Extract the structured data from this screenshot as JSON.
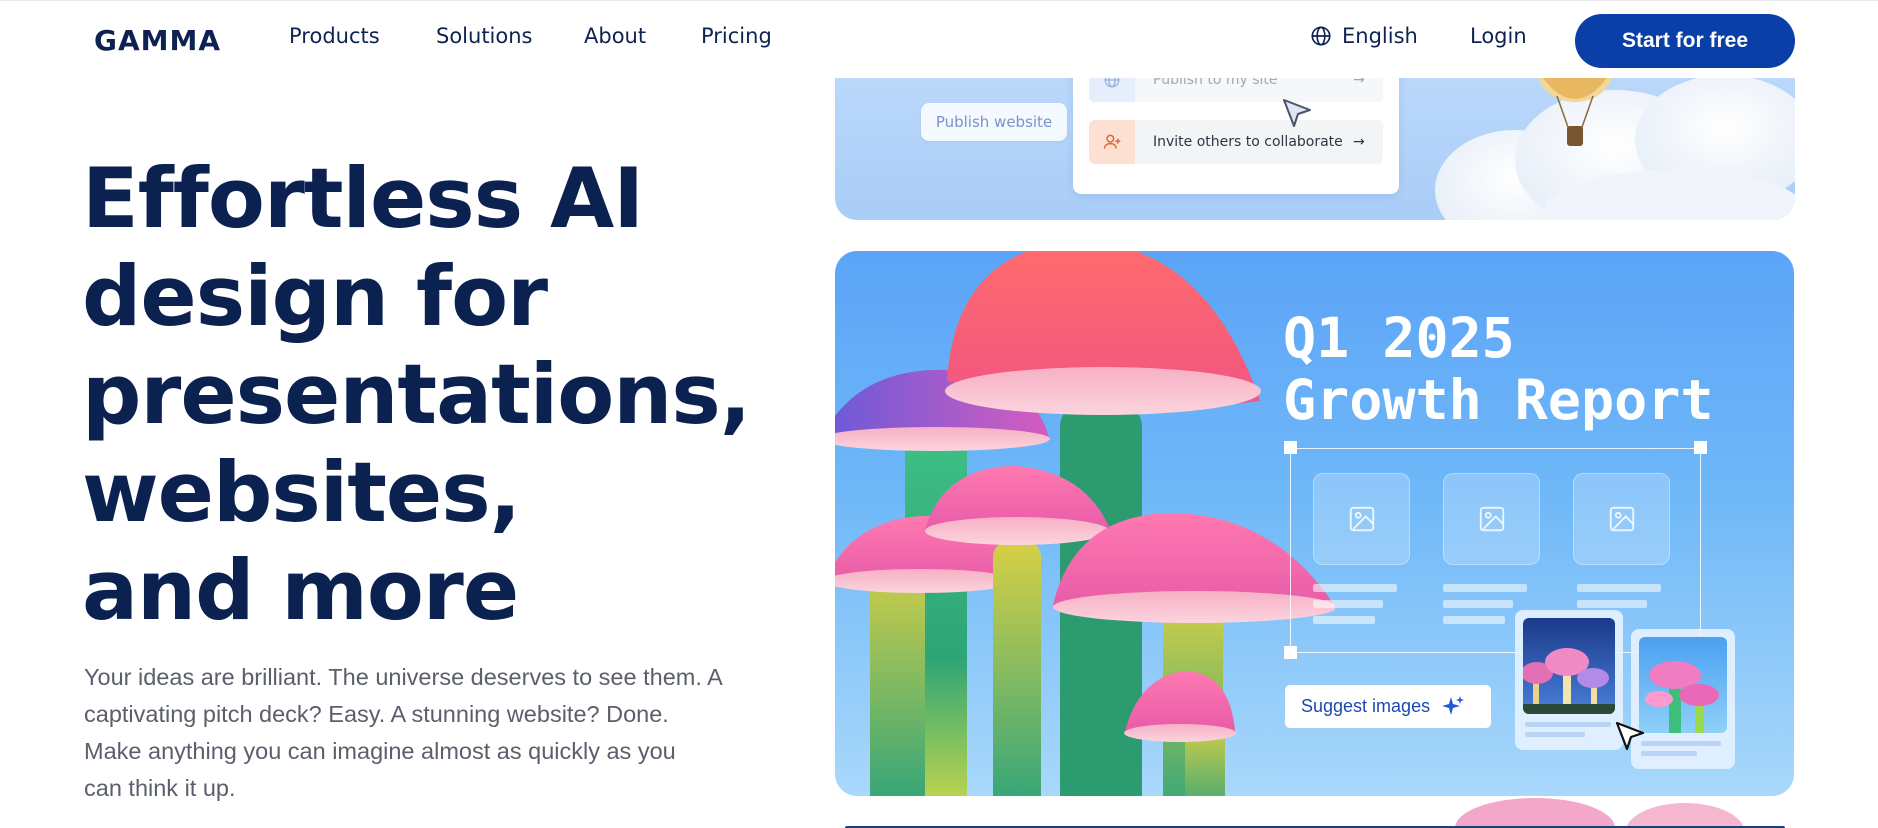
{
  "nav": {
    "logo": "GAMMA",
    "links": [
      "Products",
      "Solutions",
      "About",
      "Pricing"
    ],
    "language": "English",
    "login": "Login",
    "cta": "Start for free"
  },
  "hero": {
    "title_lines": [
      "Effortless AI",
      "design for",
      "presentations,",
      "websites,",
      "and more"
    ],
    "subtitle_lines": [
      "Your ideas are brilliant. The universe deserves to see them. A",
      "captivating pitch deck? Easy. A stunning website? Done.",
      "Make anything you can imagine almost as quickly as you",
      "can think it up."
    ]
  },
  "card_top": {
    "publish_button": "Publish website",
    "menu_items": [
      "Publish to my site",
      "Invite others to collaborate"
    ]
  },
  "card_main": {
    "title_lines": [
      "Q1 2025",
      "Growth Report"
    ],
    "suggest_button": "Suggest images"
  },
  "colors": {
    "primary": "#0a3fa8",
    "heading": "#0b2150",
    "body_text": "#5a5f6b",
    "card_blue": "#5ca4f7"
  }
}
